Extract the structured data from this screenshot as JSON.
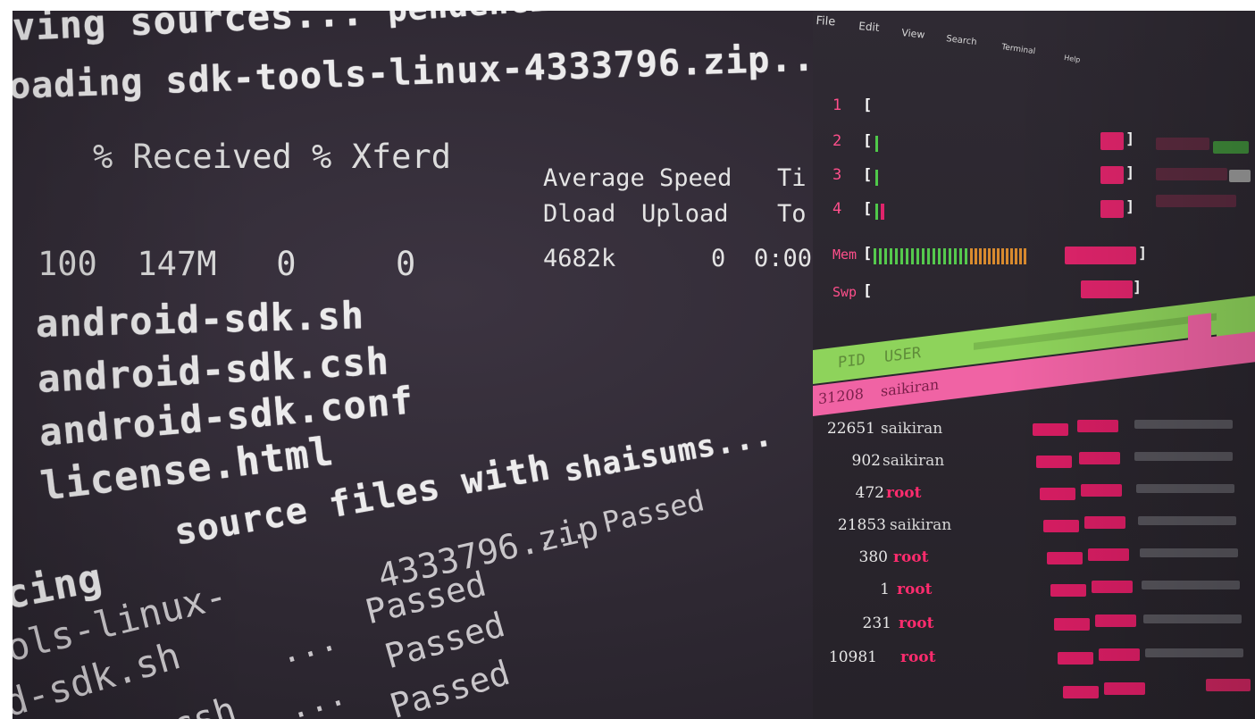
{
  "terminal": {
    "lines": {
      "l1": "ving sources...",
      "l1b": "pendencies...",
      "l2": "oading sdk-tools-linux-4333796.zip...",
      "l3": "% Received % Xferd",
      "l3b": "Average Speed",
      "l3c": "Ti",
      "l4a": "Dload",
      "l4b": "Upload",
      "l4c": "To",
      "l5": "100  147M   0     0",
      "l5b": "4682k",
      "l5c": "0",
      "l5d": "0:00",
      "l6": "android-sdk.sh",
      "l7": "android-sdk.csh",
      "l8": "android-sdk.conf",
      "l9": "license.html",
      "l10": "shaisums...",
      "l10b": "source files with",
      "l11a": "cing",
      "l11b": "... Passed",
      "l11c": "4333796.zip",
      "l12a": "ols-linux-",
      "l12b": "Passed",
      "l13a": "d-sdk.sh",
      "l13b": "...",
      "l13c": "Passed",
      "l14a": "csh",
      "l14b": "...",
      "l14c": "Passed"
    }
  },
  "htop": {
    "menu": [
      "File",
      "Edit",
      "View",
      "Search",
      "Terminal",
      "Help"
    ],
    "cpus": [
      {
        "label": "1",
        "bar": "",
        "fill": 0.0
      },
      {
        "label": "2",
        "bar": "|",
        "fill": 0.02
      },
      {
        "label": "3",
        "bar": "|",
        "fill": 0.02
      },
      {
        "label": "4",
        "bar": "||",
        "fill": 0.04
      }
    ],
    "mem_label": "Mem",
    "swp_label": "Swp",
    "header": [
      "PID",
      "USER"
    ],
    "selected": {
      "pid": "31208",
      "user": "saikiran"
    },
    "processes": [
      {
        "pid": "22651",
        "user": "saikiran"
      },
      {
        "pid": "902",
        "user": "saikiran"
      },
      {
        "pid": "472",
        "user": "root"
      },
      {
        "pid": "21853",
        "user": "saikiran"
      },
      {
        "pid": "380",
        "user": "root"
      },
      {
        "pid": "1",
        "user": "root"
      },
      {
        "pid": "231",
        "user": "root"
      },
      {
        "pid": "10981",
        "user": "root"
      }
    ],
    "colors": {
      "accent": "#e0246b",
      "green": "#8ed35b",
      "selected": "#f063a4",
      "orange": "#d88a2e"
    }
  }
}
